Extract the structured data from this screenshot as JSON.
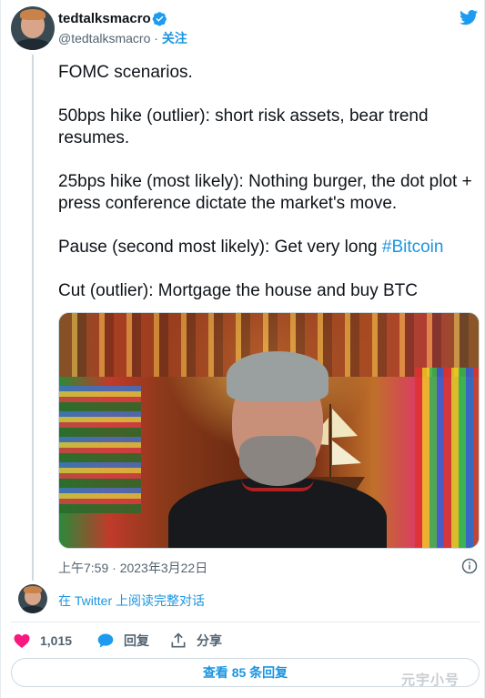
{
  "author": {
    "name": "tedtalksmacro",
    "handle": "@tedtalksmacro",
    "separator": "·",
    "follow_label": "关注"
  },
  "tweet": {
    "paragraphs": [
      "FOMC scenarios.",
      "50bps hike (outlier): short risk assets, bear trend resumes.",
      "25bps hike (most likely): Nothing burger, the dot plot + press conference dictate the market's move."
    ],
    "pause_text": "Pause (second most likely): Get very long ",
    "hashtag": "#Bitcoin",
    "last_paragraph": "Cut (outlier): Mortgage the house and buy BTC",
    "timestamp": "上午7:59 · 2023年3月22日"
  },
  "thread": {
    "read_conversation_label": "在 Twitter 上阅读完整对话"
  },
  "actions": {
    "like_count": "1,015",
    "reply_label": "回复",
    "share_label": "分享"
  },
  "more_replies_label": "查看 85 条回复",
  "watermark": "元宇小号",
  "colors": {
    "accent": "#1b95e0",
    "like": "#f91880",
    "text": "#0f1419",
    "muted": "#536471"
  },
  "icons": [
    "verified-badge-icon",
    "twitter-bird-icon",
    "info-icon",
    "heart-icon",
    "reply-bubble-icon",
    "share-icon"
  ]
}
